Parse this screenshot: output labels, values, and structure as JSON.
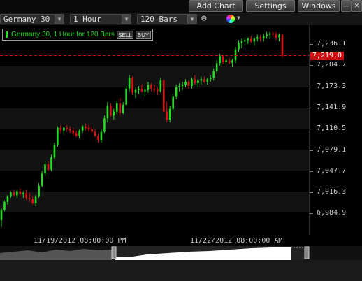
{
  "window": {
    "add_chart": "Add Chart",
    "settings": "Settings",
    "windows": "Windows",
    "minimize": "—",
    "close": "✕"
  },
  "toolbar": {
    "symbol": "Germany 30",
    "timeframe": "1 Hour",
    "bars": "120 Bars",
    "gear": "⚙",
    "color": "●"
  },
  "legend": {
    "text": "Germany 30, 1 Hour for 120 Bars",
    "sell": "SELL",
    "buy": "BUY"
  },
  "price_axis": {
    "ticks": [
      "7,236.1",
      "7,204.7",
      "7,173.3",
      "7,141.9",
      "7,110.5",
      "7,079.1",
      "7,047.7",
      "7,016.3",
      "6,984.9"
    ],
    "current_price": "7,219.0"
  },
  "time_axis": {
    "labels": [
      "11/19/2012 08:00:00 PM",
      "11/22/2012 08:00:00 AM"
    ]
  },
  "colors": {
    "up": "#22dd22",
    "down": "#dd1111",
    "current_line": "#cc1111"
  },
  "chart_data": {
    "type": "candlestick",
    "title": "Germany 30, 1 Hour for 120 Bars",
    "ylim": [
      6970,
      7260
    ],
    "x_labels": [
      "11/19/2012 08:00:00 PM",
      "11/22/2012 08:00:00 AM"
    ],
    "current_price": 7219.0,
    "ohlc": [
      [
        6975,
        6992,
        6965,
        6990
      ],
      [
        6990,
        7004,
        6988,
        7002
      ],
      [
        7002,
        7012,
        6998,
        7010
      ],
      [
        7010,
        7018,
        7008,
        7016
      ],
      [
        7016,
        7020,
        7010,
        7012
      ],
      [
        7012,
        7020,
        7008,
        7018
      ],
      [
        7018,
        7022,
        7010,
        7014
      ],
      [
        7014,
        7018,
        7008,
        7015
      ],
      [
        7015,
        7020,
        7005,
        7008
      ],
      [
        7008,
        7016,
        7002,
        7006
      ],
      [
        7006,
        7010,
        6998,
        7000
      ],
      [
        7000,
        7012,
        6996,
        7010
      ],
      [
        7010,
        7030,
        7008,
        7026
      ],
      [
        7026,
        7048,
        7024,
        7044
      ],
      [
        7044,
        7062,
        7040,
        7058
      ],
      [
        7058,
        7062,
        7048,
        7050
      ],
      [
        7050,
        7072,
        7048,
        7068
      ],
      [
        7068,
        7090,
        7066,
        7086
      ],
      [
        7086,
        7114,
        7084,
        7112
      ],
      [
        7112,
        7116,
        7104,
        7108
      ],
      [
        7108,
        7114,
        7102,
        7112
      ],
      [
        7112,
        7116,
        7106,
        7110
      ],
      [
        7110,
        7114,
        7104,
        7108
      ],
      [
        7108,
        7112,
        7100,
        7104
      ],
      [
        7104,
        7108,
        7098,
        7100
      ],
      [
        7100,
        7110,
        7096,
        7108
      ],
      [
        7108,
        7116,
        7104,
        7114
      ],
      [
        7114,
        7118,
        7108,
        7112
      ],
      [
        7112,
        7116,
        7106,
        7110
      ],
      [
        7110,
        7114,
        7104,
        7106
      ],
      [
        7106,
        7110,
        7098,
        7100
      ],
      [
        7100,
        7104,
        7090,
        7094
      ],
      [
        7094,
        7110,
        7090,
        7106
      ],
      [
        7106,
        7130,
        7104,
        7126
      ],
      [
        7126,
        7150,
        7120,
        7144
      ],
      [
        7144,
        7148,
        7128,
        7130
      ],
      [
        7130,
        7140,
        7124,
        7136
      ],
      [
        7136,
        7152,
        7132,
        7148
      ],
      [
        7148,
        7156,
        7130,
        7134
      ],
      [
        7134,
        7150,
        7132,
        7146
      ],
      [
        7146,
        7174,
        7144,
        7170
      ],
      [
        7170,
        7190,
        7166,
        7186
      ],
      [
        7186,
        7188,
        7160,
        7164
      ],
      [
        7164,
        7172,
        7156,
        7168
      ],
      [
        7168,
        7174,
        7162,
        7170
      ],
      [
        7170,
        7176,
        7164,
        7166
      ],
      [
        7166,
        7172,
        7158,
        7168
      ],
      [
        7168,
        7180,
        7164,
        7176
      ],
      [
        7176,
        7178,
        7166,
        7170
      ],
      [
        7170,
        7176,
        7164,
        7168
      ],
      [
        7168,
        7172,
        7160,
        7166
      ],
      [
        7166,
        7186,
        7164,
        7182
      ],
      [
        7182,
        7184,
        7150,
        7136
      ],
      [
        7136,
        7150,
        7120,
        7124
      ],
      [
        7124,
        7144,
        7120,
        7140
      ],
      [
        7140,
        7162,
        7136,
        7158
      ],
      [
        7158,
        7176,
        7154,
        7172
      ],
      [
        7172,
        7178,
        7166,
        7174
      ],
      [
        7174,
        7180,
        7168,
        7176
      ],
      [
        7176,
        7184,
        7172,
        7180
      ],
      [
        7180,
        7182,
        7170,
        7174
      ],
      [
        7174,
        7186,
        7170,
        7184
      ],
      [
        7184,
        7190,
        7176,
        7178
      ],
      [
        7178,
        7184,
        7172,
        7182
      ],
      [
        7182,
        7188,
        7176,
        7184
      ],
      [
        7184,
        7188,
        7178,
        7180
      ],
      [
        7180,
        7186,
        7176,
        7184
      ],
      [
        7184,
        7190,
        7180,
        7186
      ],
      [
        7186,
        7200,
        7182,
        7196
      ],
      [
        7196,
        7212,
        7192,
        7208
      ],
      [
        7208,
        7222,
        7204,
        7218
      ],
      [
        7218,
        7220,
        7206,
        7210
      ],
      [
        7210,
        7216,
        7204,
        7212
      ],
      [
        7212,
        7216,
        7206,
        7208
      ],
      [
        7208,
        7214,
        7202,
        7212
      ],
      [
        7212,
        7232,
        7208,
        7228
      ],
      [
        7228,
        7242,
        7224,
        7238
      ],
      [
        7238,
        7244,
        7230,
        7240
      ],
      [
        7240,
        7246,
        7234,
        7242
      ],
      [
        7242,
        7246,
        7236,
        7244
      ],
      [
        7244,
        7248,
        7238,
        7240
      ],
      [
        7240,
        7246,
        7234,
        7244
      ],
      [
        7244,
        7250,
        7240,
        7246
      ],
      [
        7246,
        7250,
        7240,
        7244
      ],
      [
        7244,
        7252,
        7240,
        7248
      ],
      [
        7248,
        7254,
        7244,
        7250
      ],
      [
        7250,
        7254,
        7244,
        7252
      ],
      [
        7252,
        7254,
        7246,
        7250
      ],
      [
        7250,
        7254,
        7242,
        7246
      ],
      [
        7246,
        7252,
        7240,
        7250
      ],
      [
        7250,
        7252,
        7216,
        7219
      ]
    ]
  }
}
